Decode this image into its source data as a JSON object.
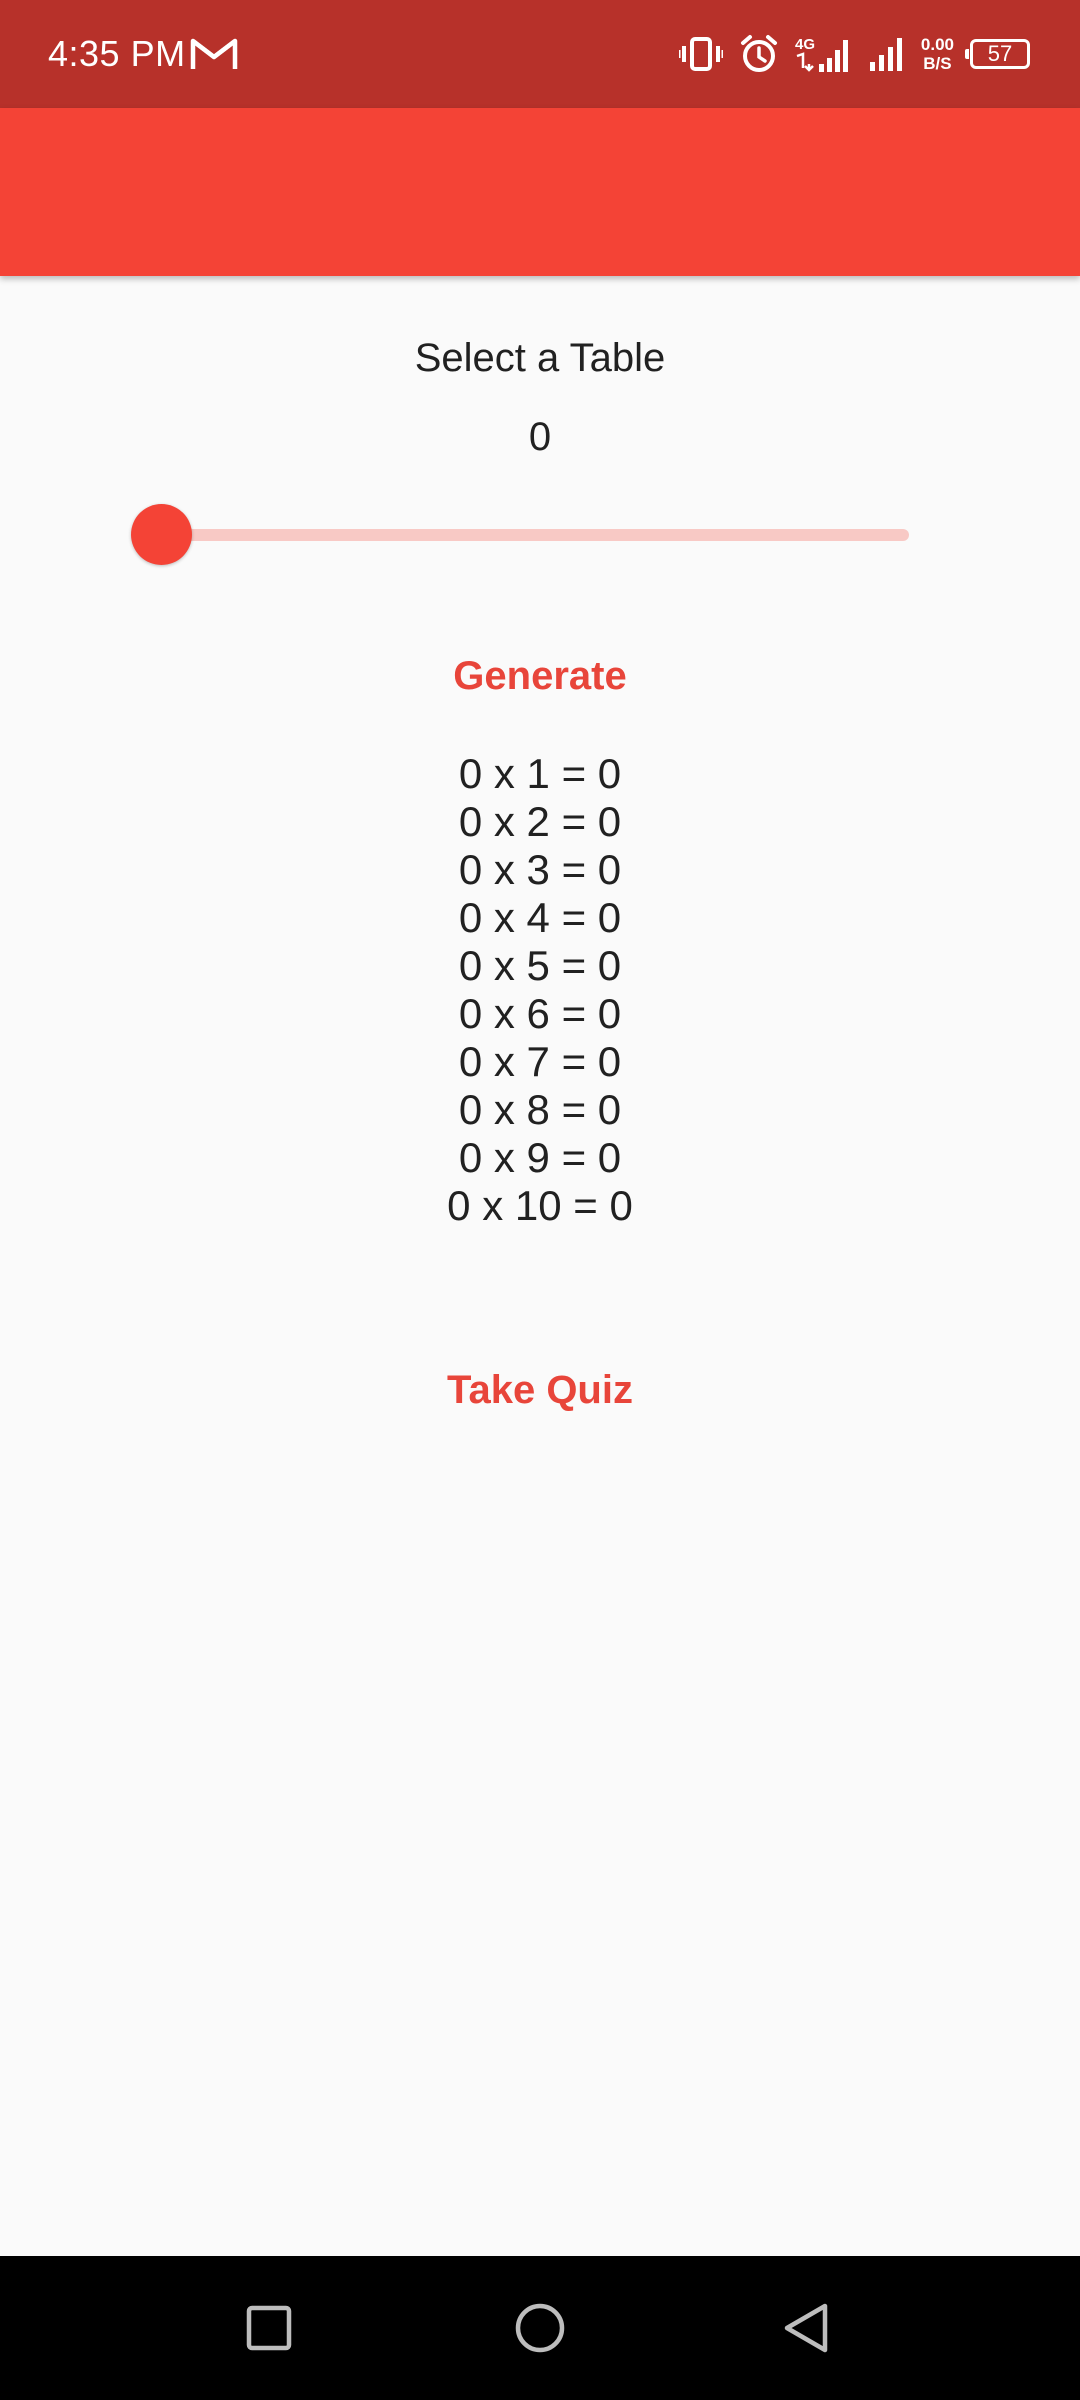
{
  "status_bar": {
    "time": "4:35 PM",
    "notification_icon": "gmail-icon",
    "icons": [
      "vibrate-icon",
      "alarm-icon",
      "signal-4g-icon",
      "signal-icon"
    ],
    "net_speed_value": "0.00",
    "net_speed_unit": "B/S",
    "battery_level": "57"
  },
  "app_bar": {
    "color": "#f44336"
  },
  "main": {
    "title": "Select a Table",
    "slider_value": "0",
    "slider_fraction": 0,
    "generate_label": "Generate",
    "table_rows": [
      "0 x 1 = 0",
      "0 x 2 = 0",
      "0 x 3 = 0",
      "0 x 4 = 0",
      "0 x 5 = 0",
      "0 x 6 = 0",
      "0 x 7 = 0",
      "0 x 8 = 0",
      "0 x 9 = 0",
      "0 x 10 = 0"
    ],
    "quiz_label": "Take Quiz"
  },
  "nav_bar": {
    "buttons": [
      "recents-icon",
      "home-icon",
      "back-icon"
    ]
  },
  "colors": {
    "status_bar": "#b7312a",
    "accent": "#f44336",
    "button_text": "#e8453a"
  }
}
